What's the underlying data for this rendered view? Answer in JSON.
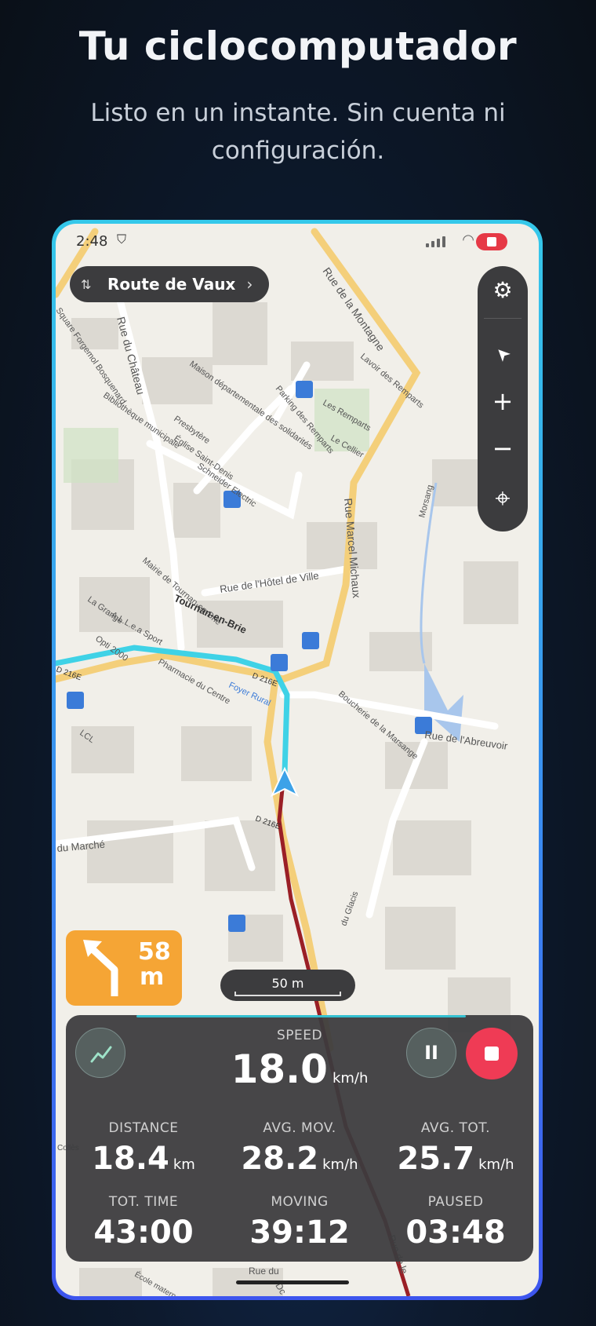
{
  "promo": {
    "title": "Tu ciclocomputador",
    "subtitle": "Listo en un instante. Sin cuenta ni configuración."
  },
  "status_bar": {
    "time": "2:48"
  },
  "route": {
    "name": "Route de Vaux",
    "icon": "route-icon",
    "chevron": "›"
  },
  "map_controls": {
    "items": [
      {
        "name": "settings",
        "icon": "gear-icon",
        "glyph": "⚙"
      },
      {
        "name": "navigate",
        "icon": "cursor-arrow-icon",
        "glyph": "➤"
      },
      {
        "name": "zoom-in",
        "icon": "plus-icon",
        "glyph": "+"
      },
      {
        "name": "zoom-out",
        "icon": "minus-icon",
        "glyph": "−"
      },
      {
        "name": "locate",
        "icon": "crosshair-icon",
        "glyph": "⌖"
      }
    ]
  },
  "map_labels": {
    "rue_montagne": "Rue de la Montagne",
    "square": "Square Forgemol Bosquenard",
    "rue_chateau": "Rue du Château",
    "maison": "Maison départementale des solidarités",
    "parking": "Parking des Remparts",
    "lavoir": "Lavoir des Remparts",
    "les_remparts": "Les Remparts",
    "bibliotheque": "Bibliothèque municipale",
    "presbytere": "Presbytère",
    "eglise": "Église Saint-Denis",
    "schneider": "Schneider Electric",
    "le_cellier": "Le Cellier",
    "rue_marcel": "Rue Marcel Michaux",
    "morsang": "Morsang",
    "mairie": "Mairie de Tournan-en-Brie",
    "hotel_ville": "Rue de l'Hôtel de Ville",
    "tournan": "Tournan-en-Brie",
    "la_grange": "La Grange",
    "allea": "A.L.L.e.a Sport",
    "opti": "Opti 2000",
    "pharmacie": "Pharmacie du Centre",
    "foyer": "Foyer Rural",
    "d216e_a": "D 216E",
    "d216e_b": "D 216E",
    "d216e_c": "D 216E",
    "boucherie": "Boucherie de la Marsange",
    "abreuvoir": "Rue de l'Abreuvoir",
    "lcl": "LCL",
    "du_marche": "du Marché",
    "glacis": "du Glacis",
    "colles": "Collès",
    "ecole": "École maternelle",
    "rue_du": "Rue du",
    "dc": "Dc",
    "rue_de_le": "Rue de le"
  },
  "navigation": {
    "turn": {
      "icon": "turn-left-arrow-icon",
      "distance": "58",
      "unit": "m"
    },
    "scale_label": "50 m"
  },
  "stats": {
    "speed": {
      "label": "SPEED",
      "value": "18.0",
      "unit": "km/h"
    },
    "distance": {
      "label": "DISTANCE",
      "value": "18.4",
      "unit": "km"
    },
    "avg_mov": {
      "label": "AVG. MOV.",
      "value": "28.2",
      "unit": "km/h"
    },
    "avg_tot": {
      "label": "AVG. TOT.",
      "value": "25.7",
      "unit": "km/h"
    },
    "tot_time": {
      "label": "TOT. TIME",
      "value": "43:00"
    },
    "moving": {
      "label": "MOVING",
      "value": "39:12"
    },
    "paused": {
      "label": "PAUSED",
      "value": "03:48"
    }
  },
  "buttons": {
    "chart": {
      "icon": "chart-line-icon"
    },
    "pause": {
      "icon": "pause-icon",
      "glyph": "II"
    },
    "stop": {
      "icon": "stop-icon"
    }
  },
  "colors": {
    "route_line": "#3fd2e6",
    "track_line": "#9a1f26",
    "turn_box": "#f5a535",
    "stop_button": "#ef3b55",
    "panel": "#3c3c3e",
    "frame_top": "#35c8ea",
    "frame_bottom": "#3d55ee"
  }
}
